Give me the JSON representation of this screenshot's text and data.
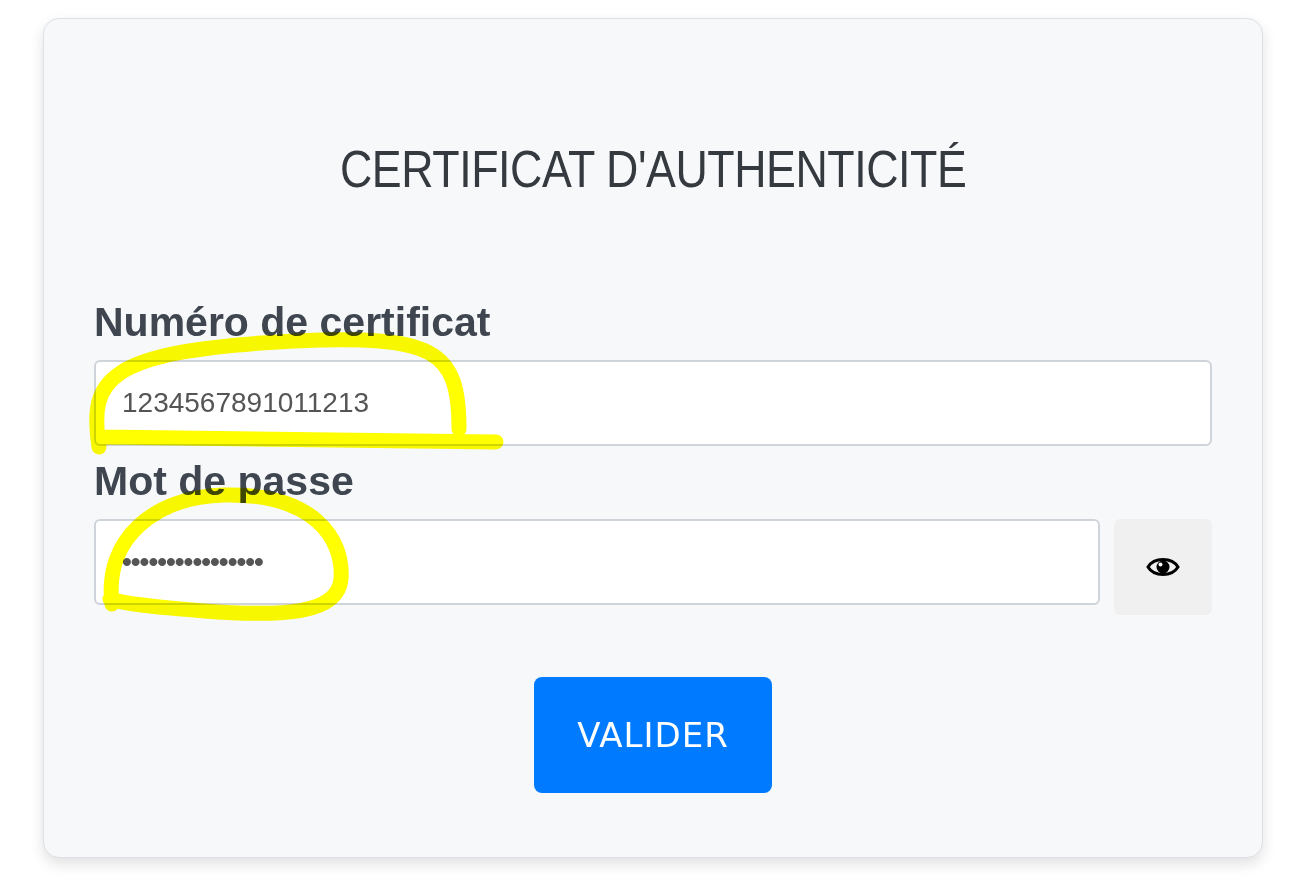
{
  "title": "CERTIFICAT D'AUTHENTICITÉ",
  "fields": [
    {
      "kind": "text",
      "label": "Numéro de certificat",
      "value": "1234567891011213",
      "highlighted": true
    },
    {
      "kind": "password",
      "label": "Mot de passe",
      "value": "••••••••••••••••",
      "highlighted": true
    }
  ],
  "submit": "VALIDER"
}
